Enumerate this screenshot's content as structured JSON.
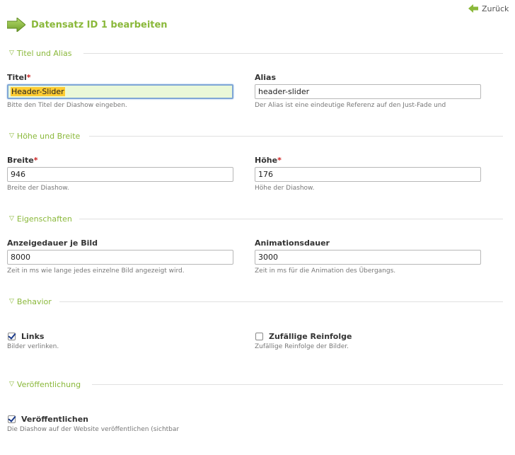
{
  "header": {
    "back_label": "Zurück",
    "title": "Datensatz ID 1 bearbeiten"
  },
  "sections": {
    "titel_alias": "Titel und Alias",
    "hoehe_breite": "Höhe und Breite",
    "eigenschaften": "Eigenschaften",
    "behavior": "Behavior",
    "veroeffentlichung": "Veröffentlichung"
  },
  "fields": {
    "titel": {
      "label": "Titel",
      "value": "Header-Slider",
      "hint": "Bitte den Titel der Diashow eingeben."
    },
    "alias": {
      "label": "Alias",
      "value": "header-slider",
      "hint": "Der Alias ist eine eindeutige Referenz auf den Just-Fade und"
    },
    "breite": {
      "label": "Breite",
      "value": "946",
      "hint": "Breite der Diashow."
    },
    "hoehe": {
      "label": "Höhe",
      "value": "176",
      "hint": "Höhe der Diashow."
    },
    "anzeigedauer": {
      "label": "Anzeigedauer je Bild",
      "value": "8000",
      "hint": "Zeit in ms wie lange jedes einzelne Bild angezeigt wird."
    },
    "animationsdauer": {
      "label": "Animationsdauer",
      "value": "3000",
      "hint": "Zeit in ms für die Animation des Übergangs."
    }
  },
  "checkboxes": {
    "links": {
      "label": "Links",
      "checked": true,
      "hint": "Bilder verlinken."
    },
    "zufall": {
      "label": "Zufällige Reinfolge",
      "checked": false,
      "hint": "Zufällige Reinfolge der Bilder."
    },
    "veroeffentlichen": {
      "label": "Veröffentlichen",
      "checked": true,
      "hint": "Die Diashow auf der Website veröffentlichen (sichtbar"
    }
  },
  "required_marker": "*",
  "colors": {
    "accent": "#8ab83a",
    "required": "#cc2222",
    "focus_bg": "#eaf8d8",
    "selection": "#ffcc33"
  }
}
